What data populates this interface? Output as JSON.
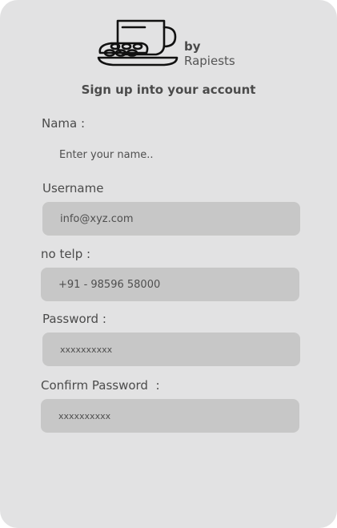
{
  "brand": {
    "by": "by",
    "name": "Rapiests"
  },
  "form": {
    "title": "Sign up into your account",
    "fields": [
      {
        "label": "Nama :",
        "value": "Enter your name.."
      },
      {
        "label": "Username",
        "value": "info@xyz.com"
      },
      {
        "label": "no telp :",
        "value": "+91 - 98596 58000"
      },
      {
        "label": "Password :",
        "value": "xxxxxxxxxx"
      },
      {
        "label": "Confirm Password  :",
        "value": "xxxxxxxxxx"
      }
    ]
  },
  "icons": {
    "logo": "teacup-with-cookies-icon"
  }
}
